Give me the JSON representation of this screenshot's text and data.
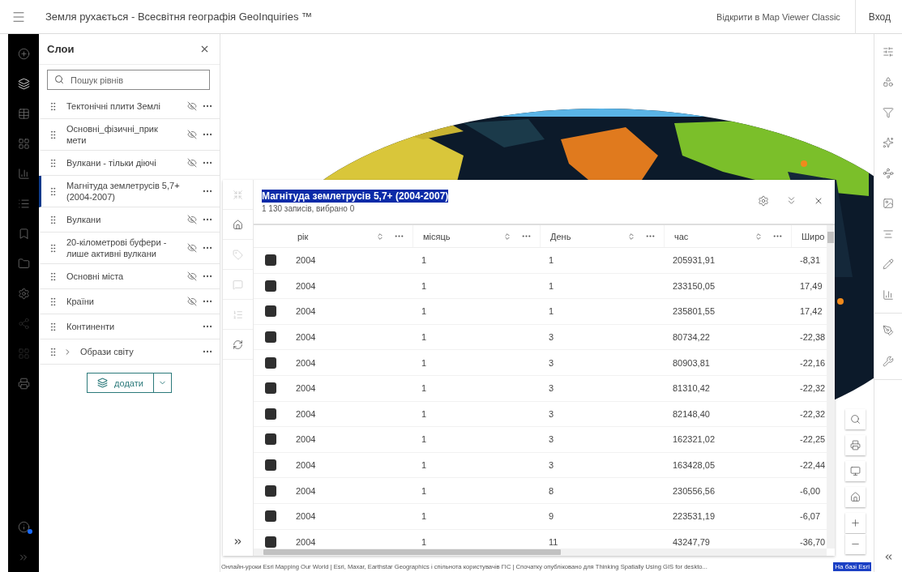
{
  "header": {
    "title": "Земля рухається - Всесвітня географія GeoInquiries ™",
    "open_classic": "Відкрити в Map Viewer Classic",
    "sign_in": "Вход"
  },
  "left_rail": {
    "items": [
      {
        "kind": "add",
        "selected": false,
        "disabled": false
      },
      {
        "kind": "layers",
        "selected": true,
        "disabled": false
      },
      {
        "kind": "table",
        "selected": false,
        "disabled": false
      },
      {
        "kind": "grid",
        "selected": false,
        "disabled": false
      },
      {
        "kind": "chart",
        "selected": false,
        "disabled": false
      },
      {
        "kind": "legend",
        "selected": false,
        "disabled": false
      },
      {
        "kind": "bookmark",
        "selected": false,
        "disabled": false
      },
      {
        "kind": "folder",
        "selected": false,
        "disabled": false
      },
      {
        "kind": "settings",
        "selected": false,
        "disabled": false
      },
      {
        "kind": "share",
        "selected": false,
        "disabled": true
      },
      {
        "kind": "grid",
        "selected": false,
        "disabled": true
      },
      {
        "kind": "print",
        "selected": false,
        "disabled": false
      }
    ],
    "info_notification": true
  },
  "layers_panel": {
    "title": "Слои",
    "search": {
      "placeholder": "Пошук рівнів"
    },
    "layers": [
      {
        "kind": "layer",
        "name": "Тектонічні плити Землі",
        "visible": false,
        "selected": false
      },
      {
        "kind": "layer",
        "name": "Основні_фізичні_прик мети",
        "visible": false,
        "selected": false
      },
      {
        "kind": "layer",
        "name": "Вулкани - тільки діючі",
        "visible": false,
        "selected": false
      },
      {
        "kind": "layer",
        "name": "Магнітуда землетрусів 5,7+ (2004-2007)",
        "visible": true,
        "selected": true
      },
      {
        "kind": "layer",
        "name": "Вулкани",
        "visible": false,
        "selected": false
      },
      {
        "kind": "layer",
        "name": "20-кілометрові буфери - лише активні вулкани",
        "visible": false,
        "selected": false
      },
      {
        "kind": "layer",
        "name": "Основні міста",
        "visible": false,
        "selected": false
      },
      {
        "kind": "layer",
        "name": "Країни",
        "visible": false,
        "selected": false
      },
      {
        "kind": "layer",
        "name": "Континенти",
        "visible": true,
        "selected": false
      },
      {
        "kind": "group",
        "name": "Образи світу",
        "visible": true,
        "selected": false,
        "expanded": false
      }
    ],
    "add_button": "додати"
  },
  "table_panel": {
    "tools": [
      {
        "kind": "collapse",
        "disabled": true
      },
      {
        "kind": "home",
        "disabled": false
      },
      {
        "kind": "tag",
        "disabled": true
      },
      {
        "kind": "comment",
        "disabled": true
      },
      {
        "kind": "list",
        "disabled": true
      },
      {
        "kind": "refresh",
        "disabled": false
      }
    ],
    "title": "Магнітуда землетрусів 5,7+ (2004-2007)",
    "title_highlighted": true,
    "subtitle": "1 130 записів, вибрано 0",
    "columns": [
      "рік",
      "місяць",
      "День",
      "час",
      "Широ"
    ],
    "rows": [
      {
        "selected": false,
        "cells": [
          "2004",
          "1",
          "1",
          "205931,91",
          "-8,31"
        ]
      },
      {
        "selected": false,
        "cells": [
          "2004",
          "1",
          "1",
          "233150,05",
          "17,49"
        ]
      },
      {
        "selected": false,
        "cells": [
          "2004",
          "1",
          "1",
          "235801,55",
          "17,42"
        ]
      },
      {
        "selected": false,
        "cells": [
          "2004",
          "1",
          "3",
          "80734,22",
          "-22,38"
        ]
      },
      {
        "selected": false,
        "cells": [
          "2004",
          "1",
          "3",
          "80903,81",
          "-22,16"
        ]
      },
      {
        "selected": false,
        "cells": [
          "2004",
          "1",
          "3",
          "81310,42",
          "-22,32"
        ]
      },
      {
        "selected": false,
        "cells": [
          "2004",
          "1",
          "3",
          "82148,40",
          "-22,32"
        ]
      },
      {
        "selected": false,
        "cells": [
          "2004",
          "1",
          "3",
          "162321,02",
          "-22,25"
        ]
      },
      {
        "selected": false,
        "cells": [
          "2004",
          "1",
          "3",
          "163428,05",
          "-22,44"
        ]
      },
      {
        "selected": false,
        "cells": [
          "2004",
          "1",
          "8",
          "230556,56",
          "-6,00"
        ]
      },
      {
        "selected": false,
        "cells": [
          "2004",
          "1",
          "9",
          "223531,19",
          "-6,07"
        ]
      },
      {
        "selected": false,
        "cells": [
          "2004",
          "1",
          "11",
          "43247,79",
          "-36,70"
        ]
      }
    ]
  },
  "map_controls": [
    {
      "kind": "search"
    },
    {
      "kind": "print"
    },
    {
      "kind": "screen"
    },
    {
      "kind": "home"
    },
    {
      "kind": "zoom_in"
    },
    {
      "kind": "zoom_out"
    }
  ],
  "right_toolbar": {
    "groups": [
      [
        {
          "kind": "properties"
        },
        {
          "kind": "shapes"
        },
        {
          "kind": "filter"
        },
        {
          "kind": "effects"
        },
        {
          "kind": "clusters"
        },
        {
          "kind": "popup"
        },
        {
          "kind": "labels"
        },
        {
          "kind": "styles"
        },
        {
          "kind": "charts"
        }
      ],
      [
        {
          "kind": "sketch"
        },
        {
          "kind": "tools"
        }
      ]
    ]
  },
  "attribution": {
    "text": "Онлайн-уроки Esri Mapping Our World | Esri, Maxar, Earthstar Geographics і спільнота користувачів ГІС | Спочатку опубліковано для Thinking Spatially Using GIS for deskto...",
    "powered_by": "На базі Esri",
    "powered_by_highlighted": true
  }
}
